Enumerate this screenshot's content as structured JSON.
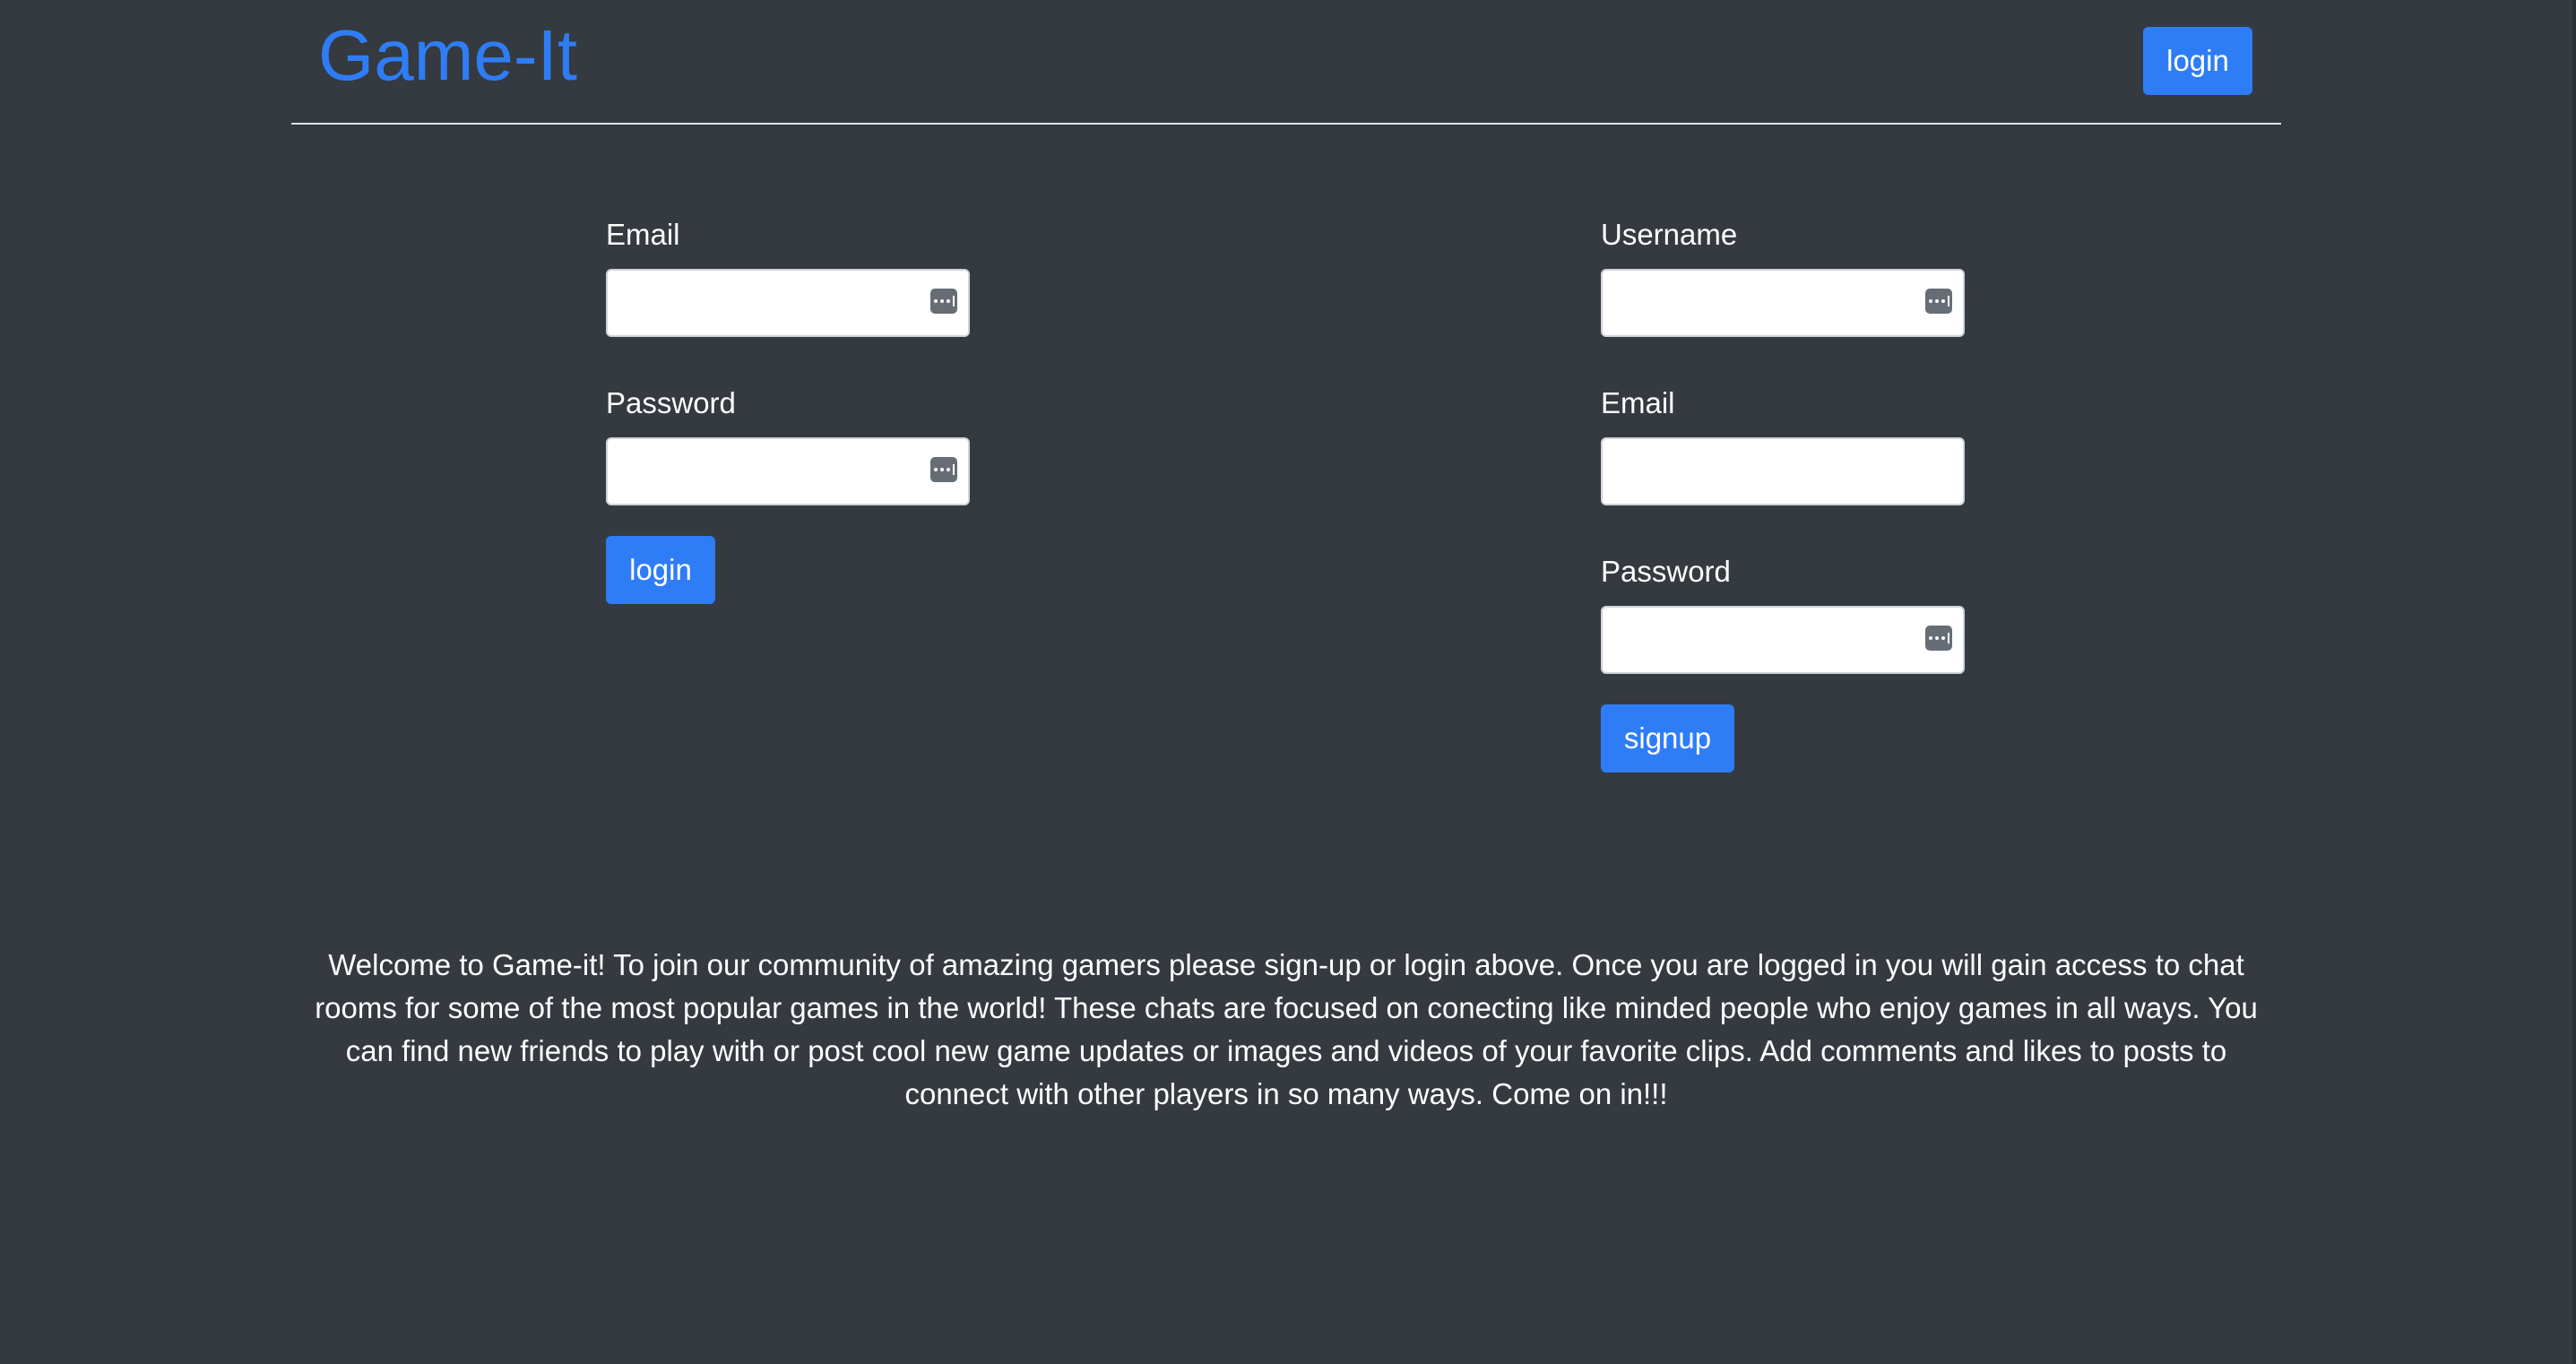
{
  "header": {
    "brand": "Game-It",
    "login_label": "login"
  },
  "login_form": {
    "email_label": "Email",
    "email_value": "",
    "password_label": "Password",
    "password_value": "",
    "submit_label": "login"
  },
  "signup_form": {
    "username_label": "Username",
    "username_value": "",
    "email_label": "Email",
    "email_value": "",
    "password_label": "Password",
    "password_value": "",
    "submit_label": "signup"
  },
  "welcome": {
    "text": "Welcome to Game-it! To join our community of amazing gamers please sign-up or login above. Once you are logged in you will gain access to chat rooms for some of the most popular games in the world! These chats are focused on conecting like minded people who enjoy games in all ways. You can find new friends to play with or post cool new game updates or images and videos of your favorite clips. Add comments and likes to posts to connect with other players in so many ways. Come on in!!!"
  },
  "colors": {
    "background": "#343a40",
    "accent": "#2f7df6",
    "text": "#ffffff"
  },
  "icons": {
    "autofill": "key-icon"
  }
}
